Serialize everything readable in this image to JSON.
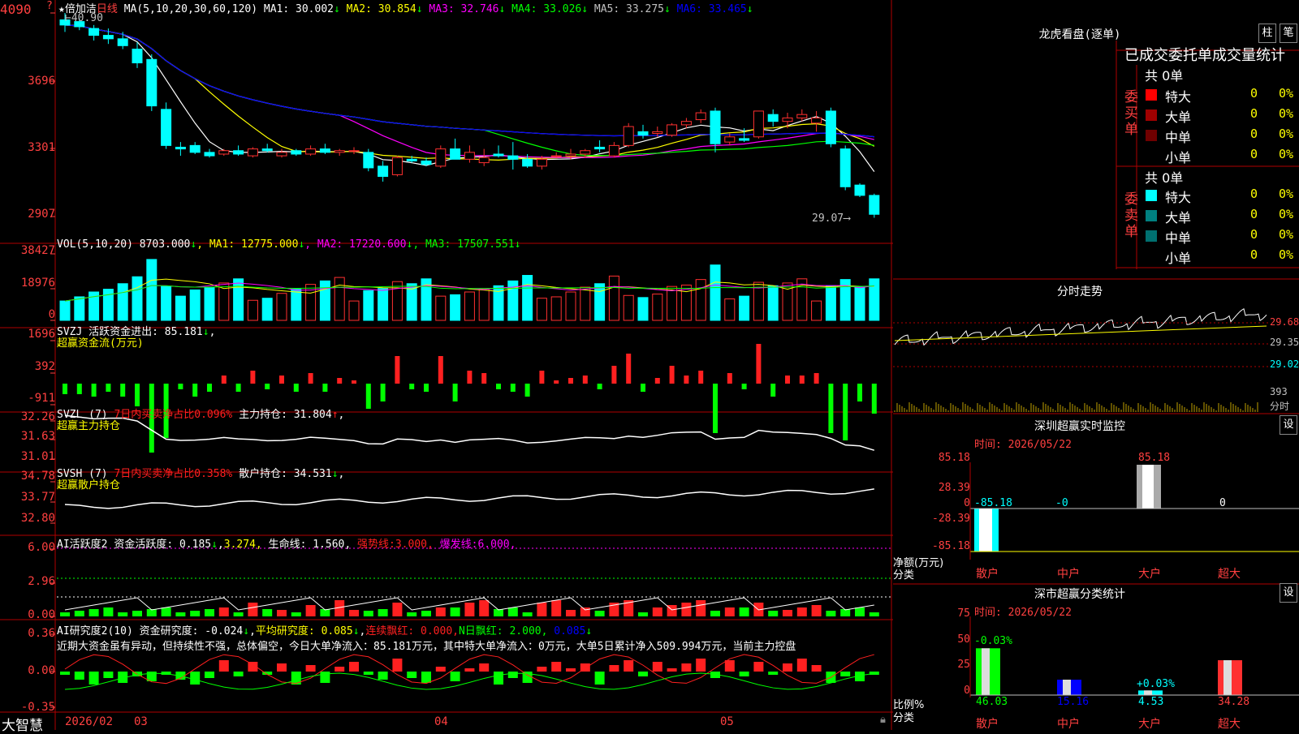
{
  "header": {
    "icon": "★",
    "stock_name": "倍加洁",
    "period": "日线",
    "ma_label": "MA(5,10,20,30,60,120)",
    "ma": [
      {
        "name": "MA1:",
        "value": "30.002",
        "color": "#ffffff"
      },
      {
        "name": "MA2:",
        "value": "30.854",
        "color": "#ffff00"
      },
      {
        "name": "MA3:",
        "value": "32.746",
        "color": "#ff00ff"
      },
      {
        "name": "MA4:",
        "value": "33.026",
        "color": "#00ff00"
      },
      {
        "name": "MA5:",
        "value": "33.275",
        "color": "#c0c0c0"
      },
      {
        "name": "MA6:",
        "value": "33.465",
        "color": "#0000ff"
      }
    ],
    "high_label": "40.90",
    "low_label": "29.07"
  },
  "price_axis": [
    "4090",
    "3696",
    "3301",
    "2907"
  ],
  "vol": {
    "label": "VOL(5,10,20)",
    "value": "8703.000",
    "ma": [
      {
        "name": "MA1:",
        "value": "12775.000",
        "color": "#ffff00"
      },
      {
        "name": "MA2:",
        "value": "17220.600",
        "color": "#ff00ff"
      },
      {
        "name": "MA3:",
        "value": "17507.551",
        "color": "#00ff00"
      }
    ],
    "axis": [
      "38427",
      "18976",
      "0"
    ]
  },
  "svzj": {
    "label": "SVZJ",
    "title": "活跃资金进出:",
    "value": "85.181",
    "sub": "超赢资金流(万元)",
    "axis": [
      "1696",
      "392",
      "-911"
    ]
  },
  "svzl": {
    "label": "SVZL (7)",
    "red": "7日内买卖净占比0.096%",
    "title": "主力持仓:",
    "value": "31.804",
    "sub": "超赢主力持仓",
    "axis": [
      "32.26",
      "31.63",
      "31.01"
    ]
  },
  "svsh": {
    "label": "SVSH (7)",
    "red": "7日内买卖净占比0.358%",
    "title": "散户持仓:",
    "value": "34.531",
    "sub": "超赢散户持仓",
    "axis": [
      "34.78",
      "33.77",
      "32.80"
    ]
  },
  "ai1": {
    "label": "AI活跃度2",
    "t1": "资金活跃度:",
    "v1": "0.185",
    "v2": "3.274,",
    "t3": "生命线:",
    "v3": "1.560,",
    "t4": "强势线:",
    "v4": "3.000,",
    "t5": "爆发线:",
    "v5": "6.000,",
    "axis": [
      "6.00",
      "2.96",
      "0.00"
    ]
  },
  "ai2": {
    "label": "AI研究度2(10)",
    "t1": "资金研究度:",
    "v1": "-0.024",
    "t2": "平均研究度:",
    "v2": "0.085",
    "t3": "连续飘红:",
    "v3": "0.000,",
    "t4": "N日飘红:",
    "v4": "2.000,",
    "v5": "0.085",
    "text": "近期大资金虽有异动，但持续性不强，总体偏空，今日大单净流入：85.181万元，其中特大单净流入：0万元，大单5日累计净入509.994万元，当前主力控盘",
    "axis": [
      "0.36",
      "0.00",
      "-0.35"
    ]
  },
  "bottom": {
    "brand": "大智慧",
    "dates": [
      "2026/02",
      "03",
      "04",
      "05"
    ]
  },
  "right": {
    "title": "龙虎看盘(逐单)",
    "btn1": "柱",
    "btn2": "笔",
    "section": "已成交委托单成交量统计",
    "buy_label": "委买单",
    "sell_label": "委卖单",
    "buy_total": "共 0单",
    "sell_total": "共 0单",
    "buy_rows": [
      {
        "name": "特大",
        "n": "0",
        "p": "0%",
        "color": "#ff0000"
      },
      {
        "name": "大单",
        "n": "0",
        "p": "0%",
        "color": "#a00000"
      },
      {
        "name": "中单",
        "n": "0",
        "p": "0%",
        "color": "#700000"
      },
      {
        "name": "小单",
        "n": "0",
        "p": "0%",
        "color": "#000000"
      }
    ],
    "sell_rows": [
      {
        "name": "特大",
        "n": "0",
        "p": "0%",
        "color": "#00ffff"
      },
      {
        "name": "大单",
        "n": "0",
        "p": "0%",
        "color": "#008080"
      },
      {
        "name": "中单",
        "n": "0",
        "p": "0%",
        "color": "#007070"
      },
      {
        "name": "小单",
        "n": "0",
        "p": "0%",
        "color": "#000000"
      }
    ],
    "intraday_title": "分时走势",
    "intraday_axis": [
      "29.68",
      "29.35",
      "29.02",
      "393",
      "分时"
    ],
    "sz_title": "深圳超赢实时监控",
    "sz_btn": "设",
    "sz_time": "时间: 2026/05/22",
    "sz_axis": [
      "85.18",
      "28.39",
      "0",
      "-28.39",
      "-85.18"
    ],
    "sz_ylabel": "净额(万元)",
    "sz_xlabel": "分类",
    "sz_vals": [
      "-85.18",
      "-0",
      "85.18",
      "0"
    ],
    "cats": [
      "散户",
      "中户",
      "大户",
      "超大"
    ],
    "cls_title": "深市超赢分类统计",
    "cls_btn": "设",
    "cls_time": "时间: 2026/05/22",
    "cls_axis": [
      "75",
      "50",
      "25",
      "0"
    ],
    "cls_ylabel": "比例%",
    "cls_xlabel": "分类",
    "cls_top": [
      "-0.03%",
      "",
      "+0.03%",
      ""
    ],
    "cls_vals": [
      "46.03",
      "15.16",
      "4.53",
      "34.28"
    ]
  },
  "chart_data": {
    "type": "candlestick",
    "n": 57,
    "candles": [
      [
        40.5,
        40.9,
        39.8,
        40.2
      ],
      [
        40.4,
        40.6,
        39.9,
        40.1
      ],
      [
        40.0,
        40.2,
        39.3,
        39.6
      ],
      [
        39.6,
        40.0,
        39.1,
        39.4
      ],
      [
        39.4,
        39.8,
        38.8,
        39.0
      ],
      [
        38.8,
        39.2,
        37.7,
        38.0
      ],
      [
        38.2,
        38.5,
        35.2,
        35.5
      ],
      [
        35.3,
        35.7,
        33.0,
        33.2
      ],
      [
        33.1,
        33.4,
        32.6,
        33.0
      ],
      [
        33.2,
        33.4,
        32.7,
        32.8
      ],
      [
        32.8,
        33.0,
        32.5,
        32.6
      ],
      [
        32.7,
        33.0,
        32.6,
        32.9
      ],
      [
        32.9,
        33.2,
        32.6,
        32.7
      ],
      [
        32.6,
        33.1,
        32.5,
        33.0
      ],
      [
        33.0,
        33.3,
        32.8,
        32.9
      ],
      [
        32.6,
        33.0,
        32.5,
        32.8
      ],
      [
        32.9,
        33.0,
        32.6,
        32.7
      ],
      [
        32.7,
        33.2,
        32.6,
        33.0
      ],
      [
        33.0,
        33.3,
        32.7,
        32.8
      ],
      [
        32.8,
        33.0,
        32.6,
        32.9
      ],
      [
        32.9,
        33.1,
        32.7,
        32.9
      ],
      [
        32.8,
        33.0,
        31.7,
        31.9
      ],
      [
        32.0,
        32.3,
        31.1,
        31.4
      ],
      [
        31.5,
        32.6,
        31.4,
        32.5
      ],
      [
        32.4,
        32.6,
        32.2,
        32.3
      ],
      [
        32.3,
        32.5,
        32.0,
        32.1
      ],
      [
        32.0,
        33.2,
        31.9,
        33.0
      ],
      [
        33.0,
        33.6,
        32.7,
        32.4
      ],
      [
        32.4,
        33.2,
        32.2,
        32.8
      ],
      [
        32.2,
        33.0,
        32.0,
        32.5
      ],
      [
        32.7,
        33.2,
        32.5,
        32.6
      ],
      [
        32.6,
        33.4,
        31.8,
        32.4
      ],
      [
        32.4,
        32.7,
        31.9,
        32.0
      ],
      [
        32.0,
        32.6,
        31.8,
        32.4
      ],
      [
        32.6,
        32.8,
        32.5,
        32.6
      ],
      [
        32.6,
        33.0,
        32.4,
        32.7
      ],
      [
        32.7,
        33.0,
        32.5,
        32.9
      ],
      [
        33.1,
        33.5,
        32.8,
        33.0
      ],
      [
        32.6,
        33.4,
        32.5,
        33.2
      ],
      [
        33.2,
        34.5,
        33.1,
        34.3
      ],
      [
        34.0,
        34.4,
        33.6,
        33.8
      ],
      [
        33.9,
        34.3,
        33.7,
        34.0
      ],
      [
        33.8,
        34.5,
        33.7,
        34.4
      ],
      [
        34.4,
        34.8,
        34.2,
        34.6
      ],
      [
        34.7,
        35.3,
        34.5,
        35.1
      ],
      [
        35.2,
        35.4,
        32.8,
        33.3
      ],
      [
        33.4,
        33.9,
        33.2,
        33.7
      ],
      [
        33.6,
        34.2,
        33.4,
        33.5
      ],
      [
        33.7,
        35.2,
        33.6,
        35.2
      ],
      [
        35.0,
        35.3,
        34.3,
        34.6
      ],
      [
        34.6,
        35.1,
        34.2,
        34.8
      ],
      [
        34.8,
        35.3,
        34.6,
        35.0
      ],
      [
        34.5,
        35.2,
        34.0,
        34.8
      ],
      [
        35.2,
        35.4,
        33.1,
        33.3
      ],
      [
        33.0,
        33.2,
        30.6,
        30.8
      ],
      [
        30.9,
        31.0,
        30.2,
        30.3
      ],
      [
        30.3,
        30.4,
        29.0,
        29.2
      ]
    ]
  }
}
